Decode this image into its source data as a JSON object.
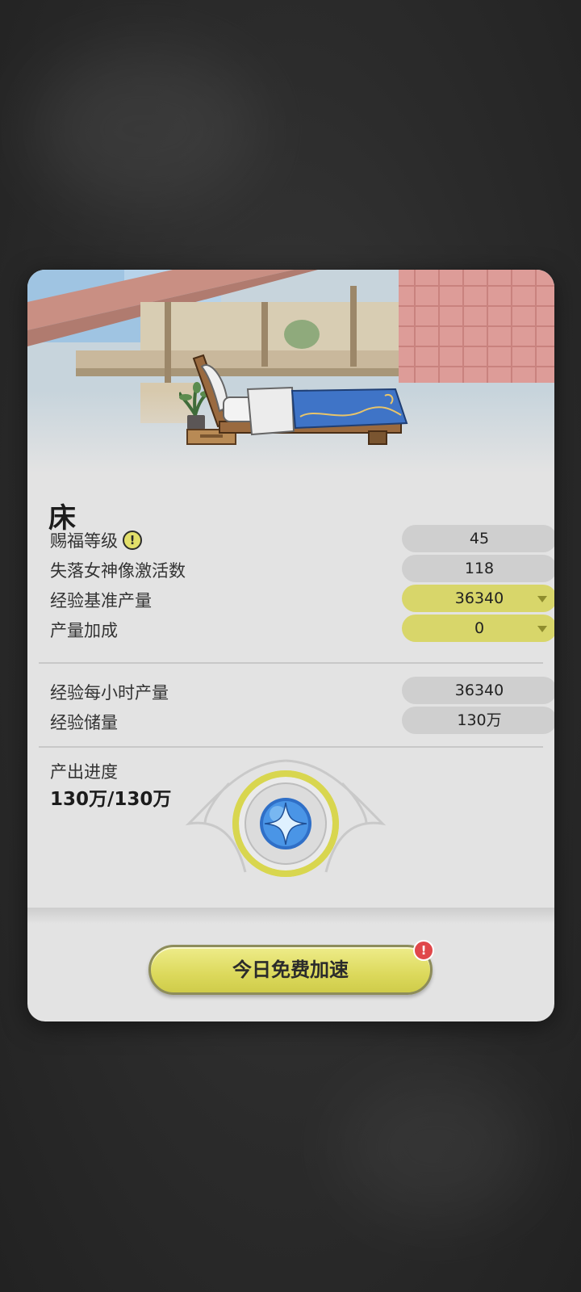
{
  "furniture": {
    "name": "床"
  },
  "stats": [
    {
      "label": "赐福等级",
      "value": "45",
      "has_info": true,
      "style": "gray"
    },
    {
      "label": "失落女神像激活数",
      "value": "118",
      "has_info": false,
      "style": "gray"
    },
    {
      "label": "经验基准产量",
      "value": "36340",
      "has_info": false,
      "style": "yellow",
      "dropdown": true
    },
    {
      "label": "产量加成",
      "value": "0",
      "has_info": false,
      "style": "yellow",
      "dropdown": true
    }
  ],
  "output": [
    {
      "label": "经验每小时产量",
      "value": "36340"
    },
    {
      "label": "经验储量",
      "value": "130万"
    }
  ],
  "progress": {
    "label": "产出进度",
    "value": "130万/130万",
    "fraction": 1.0
  },
  "boost_button": {
    "label": "今日免费加速",
    "badge": "!"
  },
  "info_icon_glyph": "!",
  "colors": {
    "accent_yellow": "#d8d66a",
    "ring_yellow": "#e0df5a",
    "orb_blue": "#3d8fe0",
    "alert_red": "#e0474a"
  }
}
